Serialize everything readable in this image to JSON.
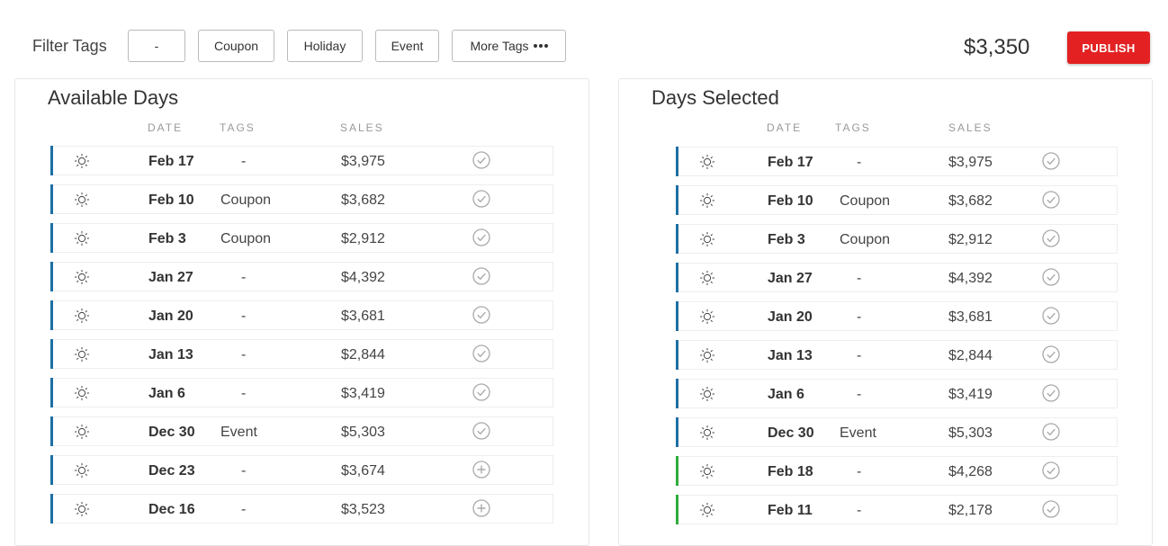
{
  "header": {
    "filter_label": "Filter Tags",
    "filter_buttons": [
      {
        "label": "-"
      },
      {
        "label": "Coupon"
      },
      {
        "label": "Holiday"
      },
      {
        "label": "Event"
      },
      {
        "label": "More Tags"
      }
    ],
    "total": "$3,350",
    "publish_label": "PUBLISH"
  },
  "colors": {
    "accent_blue": "#1d6fa5",
    "accent_green": "#2eac3b",
    "publish_red": "#e32122"
  },
  "available": {
    "title": "Available Days",
    "columns": [
      "DATE",
      "TAGS",
      "SALES"
    ],
    "rows": [
      {
        "date": "Feb 17",
        "tag": "-",
        "sales": "$3,975",
        "action": "check",
        "bar": "blue"
      },
      {
        "date": "Feb 10",
        "tag": "Coupon",
        "sales": "$3,682",
        "action": "check",
        "bar": "blue"
      },
      {
        "date": "Feb 3",
        "tag": "Coupon",
        "sales": "$2,912",
        "action": "check",
        "bar": "blue"
      },
      {
        "date": "Jan 27",
        "tag": "-",
        "sales": "$4,392",
        "action": "check",
        "bar": "blue"
      },
      {
        "date": "Jan 20",
        "tag": "-",
        "sales": "$3,681",
        "action": "check",
        "bar": "blue"
      },
      {
        "date": "Jan 13",
        "tag": "-",
        "sales": "$2,844",
        "action": "check",
        "bar": "blue"
      },
      {
        "date": "Jan 6",
        "tag": "-",
        "sales": "$3,419",
        "action": "check",
        "bar": "blue"
      },
      {
        "date": "Dec 30",
        "tag": "Event",
        "sales": "$5,303",
        "action": "check",
        "bar": "blue"
      },
      {
        "date": "Dec 23",
        "tag": "-",
        "sales": "$3,674",
        "action": "add",
        "bar": "blue"
      },
      {
        "date": "Dec 16",
        "tag": "-",
        "sales": "$3,523",
        "action": "add",
        "bar": "blue"
      }
    ]
  },
  "selected": {
    "title": "Days Selected",
    "columns": [
      "DATE",
      "TAGS",
      "SALES"
    ],
    "rows": [
      {
        "date": "Feb 17",
        "tag": "-",
        "sales": "$3,975",
        "action": "check",
        "bar": "blue"
      },
      {
        "date": "Feb 10",
        "tag": "Coupon",
        "sales": "$3,682",
        "action": "check",
        "bar": "blue"
      },
      {
        "date": "Feb 3",
        "tag": "Coupon",
        "sales": "$2,912",
        "action": "check",
        "bar": "blue"
      },
      {
        "date": "Jan 27",
        "tag": "-",
        "sales": "$4,392",
        "action": "check",
        "bar": "blue"
      },
      {
        "date": "Jan 20",
        "tag": "-",
        "sales": "$3,681",
        "action": "check",
        "bar": "blue"
      },
      {
        "date": "Jan 13",
        "tag": "-",
        "sales": "$2,844",
        "action": "check",
        "bar": "blue"
      },
      {
        "date": "Jan 6",
        "tag": "-",
        "sales": "$3,419",
        "action": "check",
        "bar": "blue"
      },
      {
        "date": "Dec 30",
        "tag": "Event",
        "sales": "$5,303",
        "action": "check",
        "bar": "blue"
      },
      {
        "date": "Feb 18",
        "tag": "-",
        "sales": "$4,268",
        "action": "check",
        "bar": "green"
      },
      {
        "date": "Feb 11",
        "tag": "-",
        "sales": "$2,178",
        "action": "check",
        "bar": "green"
      }
    ]
  }
}
